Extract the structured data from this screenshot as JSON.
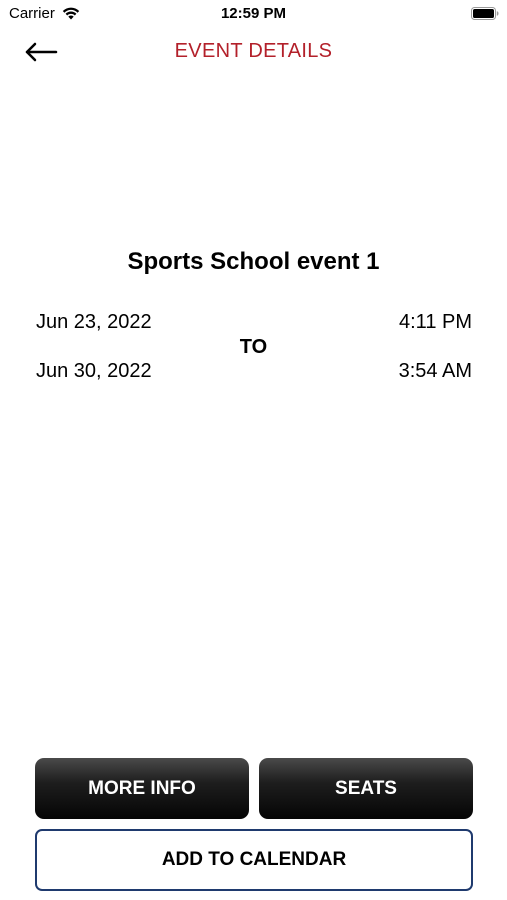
{
  "status_bar": {
    "carrier": "Carrier",
    "time": "12:59 PM",
    "wifi_icon": "wifi-icon",
    "battery_icon": "battery-icon"
  },
  "nav": {
    "back_icon": "arrow-left-icon",
    "title": "EVENT DETAILS",
    "title_color": "#b3202a"
  },
  "event": {
    "title": "Sports School event 1",
    "start_date": "Jun 23, 2022",
    "start_time": "4:11 PM",
    "separator": "TO",
    "end_date": "Jun 30, 2022",
    "end_time": "3:54 AM"
  },
  "actions": {
    "more_info_label": "MORE INFO",
    "seats_label": "SEATS",
    "add_to_calendar_label": "ADD TO CALENDAR",
    "outline_border_color": "#1f3a6e"
  }
}
